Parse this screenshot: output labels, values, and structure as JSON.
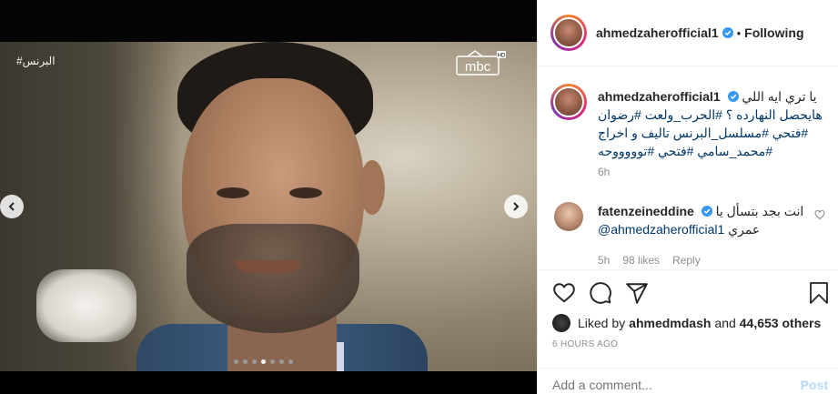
{
  "media": {
    "tag": "البرنس#",
    "logo_text": "mbc",
    "logo_badge": "HD",
    "dots_count": 7,
    "active_dot": 4
  },
  "header": {
    "username": "ahmedzaherofficial1",
    "separator": "•",
    "follow_label": "Following"
  },
  "caption": {
    "username": "ahmedzaherofficial1",
    "line1": "يا تري ايه اللي",
    "line2": "هايحصل النهارده ؟ #الحرب_ولعت #رضوان",
    "line3": "#فتحي #مسلسل_البرنس تاليف و اخراج",
    "line4": "#محمد_سامي #فتحي #توووووحه",
    "time": "6h"
  },
  "comment": {
    "username": "fatenzeineddine",
    "text_start": "انت بجد بتسأل يا",
    "mention": "@ahmedzaherofficial1",
    "text_end": "عمري",
    "time": "5h",
    "likes": "98 likes",
    "reply": "Reply"
  },
  "likes": {
    "prefix": "Liked by",
    "user": "ahmedmdash",
    "middle": "and",
    "count": "44,653 others"
  },
  "time_ago": "6 HOURS AGO",
  "add_comment": {
    "placeholder": "Add a comment...",
    "post_label": "Post"
  },
  "icons": [
    "heart-icon",
    "comment-icon",
    "share-icon",
    "bookmark-icon",
    "verified-icon",
    "chevron-left-icon",
    "chevron-right-icon"
  ],
  "colors": {
    "link": "#00376b",
    "verified": "#3897f0",
    "post_disabled": "#b3dbff",
    "meta": "#8e8e8e"
  }
}
